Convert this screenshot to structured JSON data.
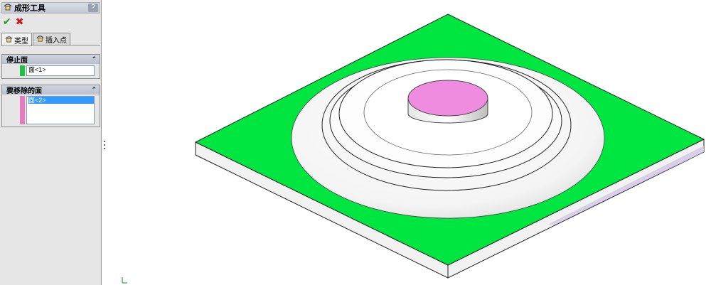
{
  "panel": {
    "title": "成形工具",
    "help": "?",
    "actions": {
      "ok": "✔",
      "cancel": "✖"
    },
    "tabs": [
      {
        "label": "类型",
        "active": true
      },
      {
        "label": "插入点",
        "active": false
      }
    ],
    "stop_face": {
      "header": "停止面",
      "collapse": "⌃",
      "swatch_color": "#20c040",
      "items": [
        "面<1>"
      ]
    },
    "faces_to_remove": {
      "header": "要移除的面",
      "collapse": "⌃",
      "swatch_color": "#e87ac0",
      "items": [
        "面<2>"
      ]
    }
  },
  "model": {
    "plate_top_color": "#00e640",
    "plate_side_color": "#f2f2f2",
    "plate_side_shadow": "#d2c6e6",
    "boss_color": "#ffffff",
    "cap_color": "#f08ce0"
  }
}
